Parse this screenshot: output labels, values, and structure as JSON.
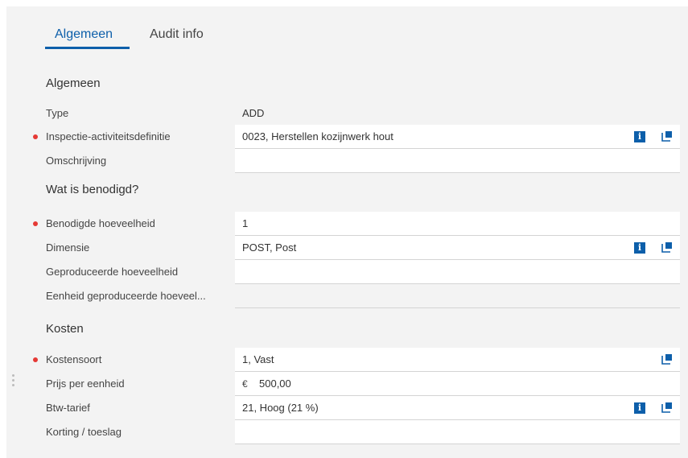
{
  "tabs": [
    {
      "label": "Algemeen",
      "active": true
    },
    {
      "label": "Audit info",
      "active": false
    }
  ],
  "sections": {
    "algemeen": {
      "title": "Algemeen",
      "type": {
        "label": "Type",
        "value": "ADD"
      },
      "inspectie": {
        "label": "Inspectie-activiteitsdefinitie",
        "value": "0023, Herstellen kozijnwerk hout",
        "required": true
      },
      "omschrijving": {
        "label": "Omschrijving",
        "value": ""
      }
    },
    "benodigd": {
      "title": "Wat is benodigd?",
      "hoeveelheid": {
        "label": "Benodigde hoeveelheid",
        "value": "1",
        "required": true
      },
      "dimensie": {
        "label": "Dimensie",
        "value": "POST, Post"
      },
      "geproduceerd": {
        "label": "Geproduceerde hoeveelheid",
        "value": ""
      },
      "eenheid": {
        "label": "Eenheid geproduceerde hoeveel...",
        "value": ""
      }
    },
    "kosten": {
      "title": "Kosten",
      "kostensoort": {
        "label": "Kostensoort",
        "value": "1, Vast",
        "required": true
      },
      "prijs": {
        "label": "Prijs per eenheid",
        "currency": "€",
        "value": "500,00"
      },
      "btw": {
        "label": "Btw-tarief",
        "value": "21, Hoog (21 %)"
      },
      "korting": {
        "label": "Korting / toeslag",
        "value": ""
      }
    }
  },
  "icons": {
    "info": "info-icon",
    "open": "open-detail-icon",
    "info_glyph": "i"
  },
  "colors": {
    "accent": "#0d5faa",
    "required": "#e53935",
    "panel_bg": "#f3f3f3"
  }
}
